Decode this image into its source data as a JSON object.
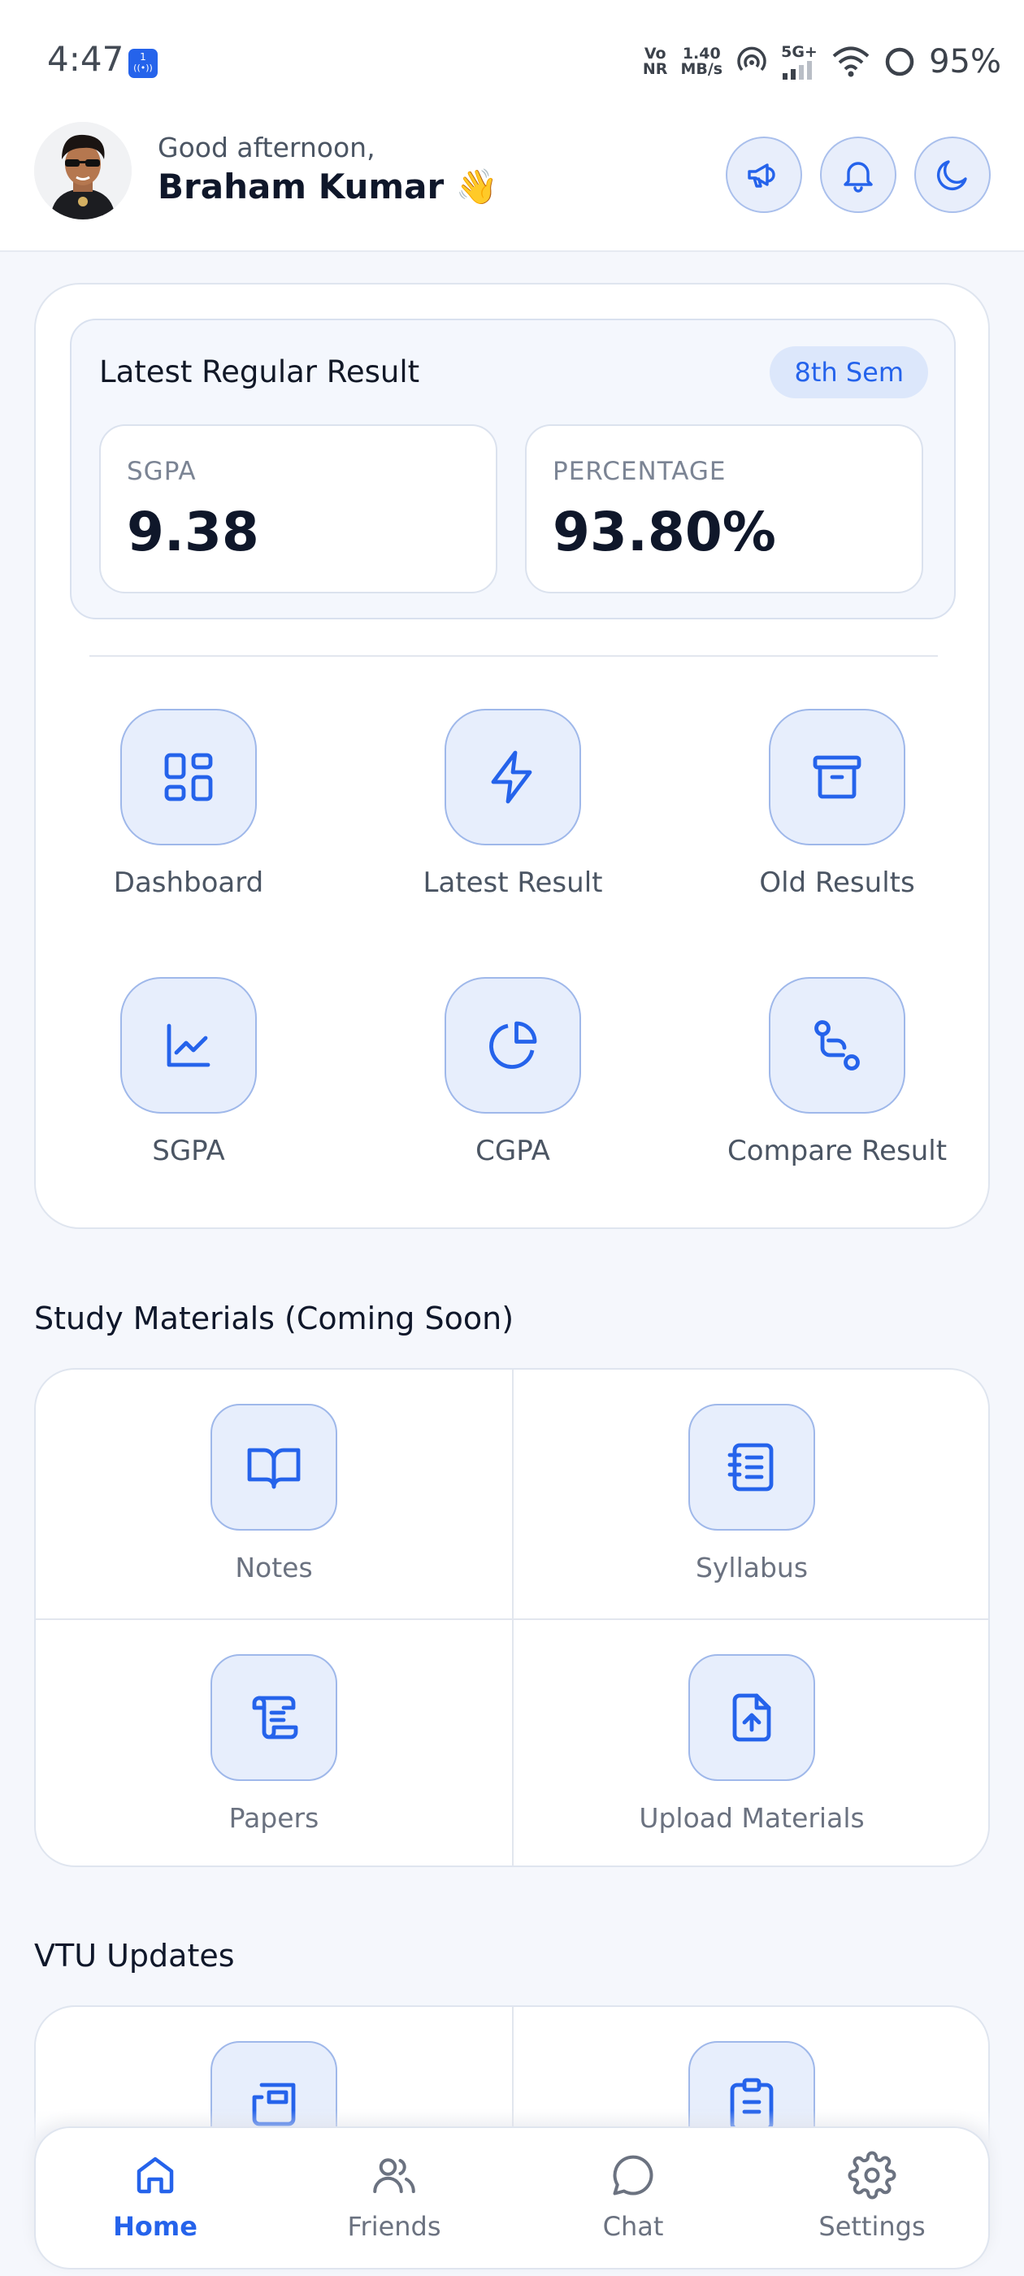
{
  "status_bar": {
    "time": "4:47",
    "badge_top": "1",
    "badge_bottom": "((•))",
    "vo_top": "Vo",
    "vo_bottom": "NR",
    "speed_top": "1.40",
    "speed_bottom": "MB/s",
    "network": "5G+",
    "battery": "95%"
  },
  "header": {
    "greeting": "Good afternoon,",
    "name": "Braham Kumar 👋",
    "buttons": [
      "megaphone-icon",
      "bell-icon",
      "moon-icon"
    ]
  },
  "result": {
    "title": "Latest Regular Result",
    "semester": "8th Sem",
    "sgpa_label": "SGPA",
    "sgpa_value": "9.38",
    "percentage_label": "PERCENTAGE",
    "percentage_value": "93.80%"
  },
  "menu": [
    {
      "label": "Dashboard",
      "icon": "grid-icon"
    },
    {
      "label": "Latest Result",
      "icon": "lightning-icon"
    },
    {
      "label": "Old Results",
      "icon": "archive-icon"
    },
    {
      "label": "SGPA",
      "icon": "line-chart-icon"
    },
    {
      "label": "CGPA",
      "icon": "pie-chart-icon"
    },
    {
      "label": "Compare Result",
      "icon": "compare-icon"
    }
  ],
  "study": {
    "title": "Study Materials (Coming Soon)",
    "items": [
      {
        "label": "Notes",
        "icon": "book-icon"
      },
      {
        "label": "Syllabus",
        "icon": "notebook-icon"
      },
      {
        "label": "Papers",
        "icon": "scroll-icon"
      },
      {
        "label": "Upload Materials",
        "icon": "file-upload-icon"
      }
    ]
  },
  "vtu": {
    "title": "VTU Updates",
    "items": [
      {
        "icon": "news-icon"
      },
      {
        "icon": "clipboard-icon"
      }
    ]
  },
  "nav": [
    {
      "label": "Home",
      "icon": "home-icon",
      "active": true
    },
    {
      "label": "Friends",
      "icon": "friends-icon",
      "active": false
    },
    {
      "label": "Chat",
      "icon": "chat-icon",
      "active": false
    },
    {
      "label": "Settings",
      "icon": "settings-icon",
      "active": false
    }
  ],
  "colors": {
    "accent": "#2563eb",
    "icon_bg": "#e7eefc",
    "background": "#f5f7fc"
  }
}
